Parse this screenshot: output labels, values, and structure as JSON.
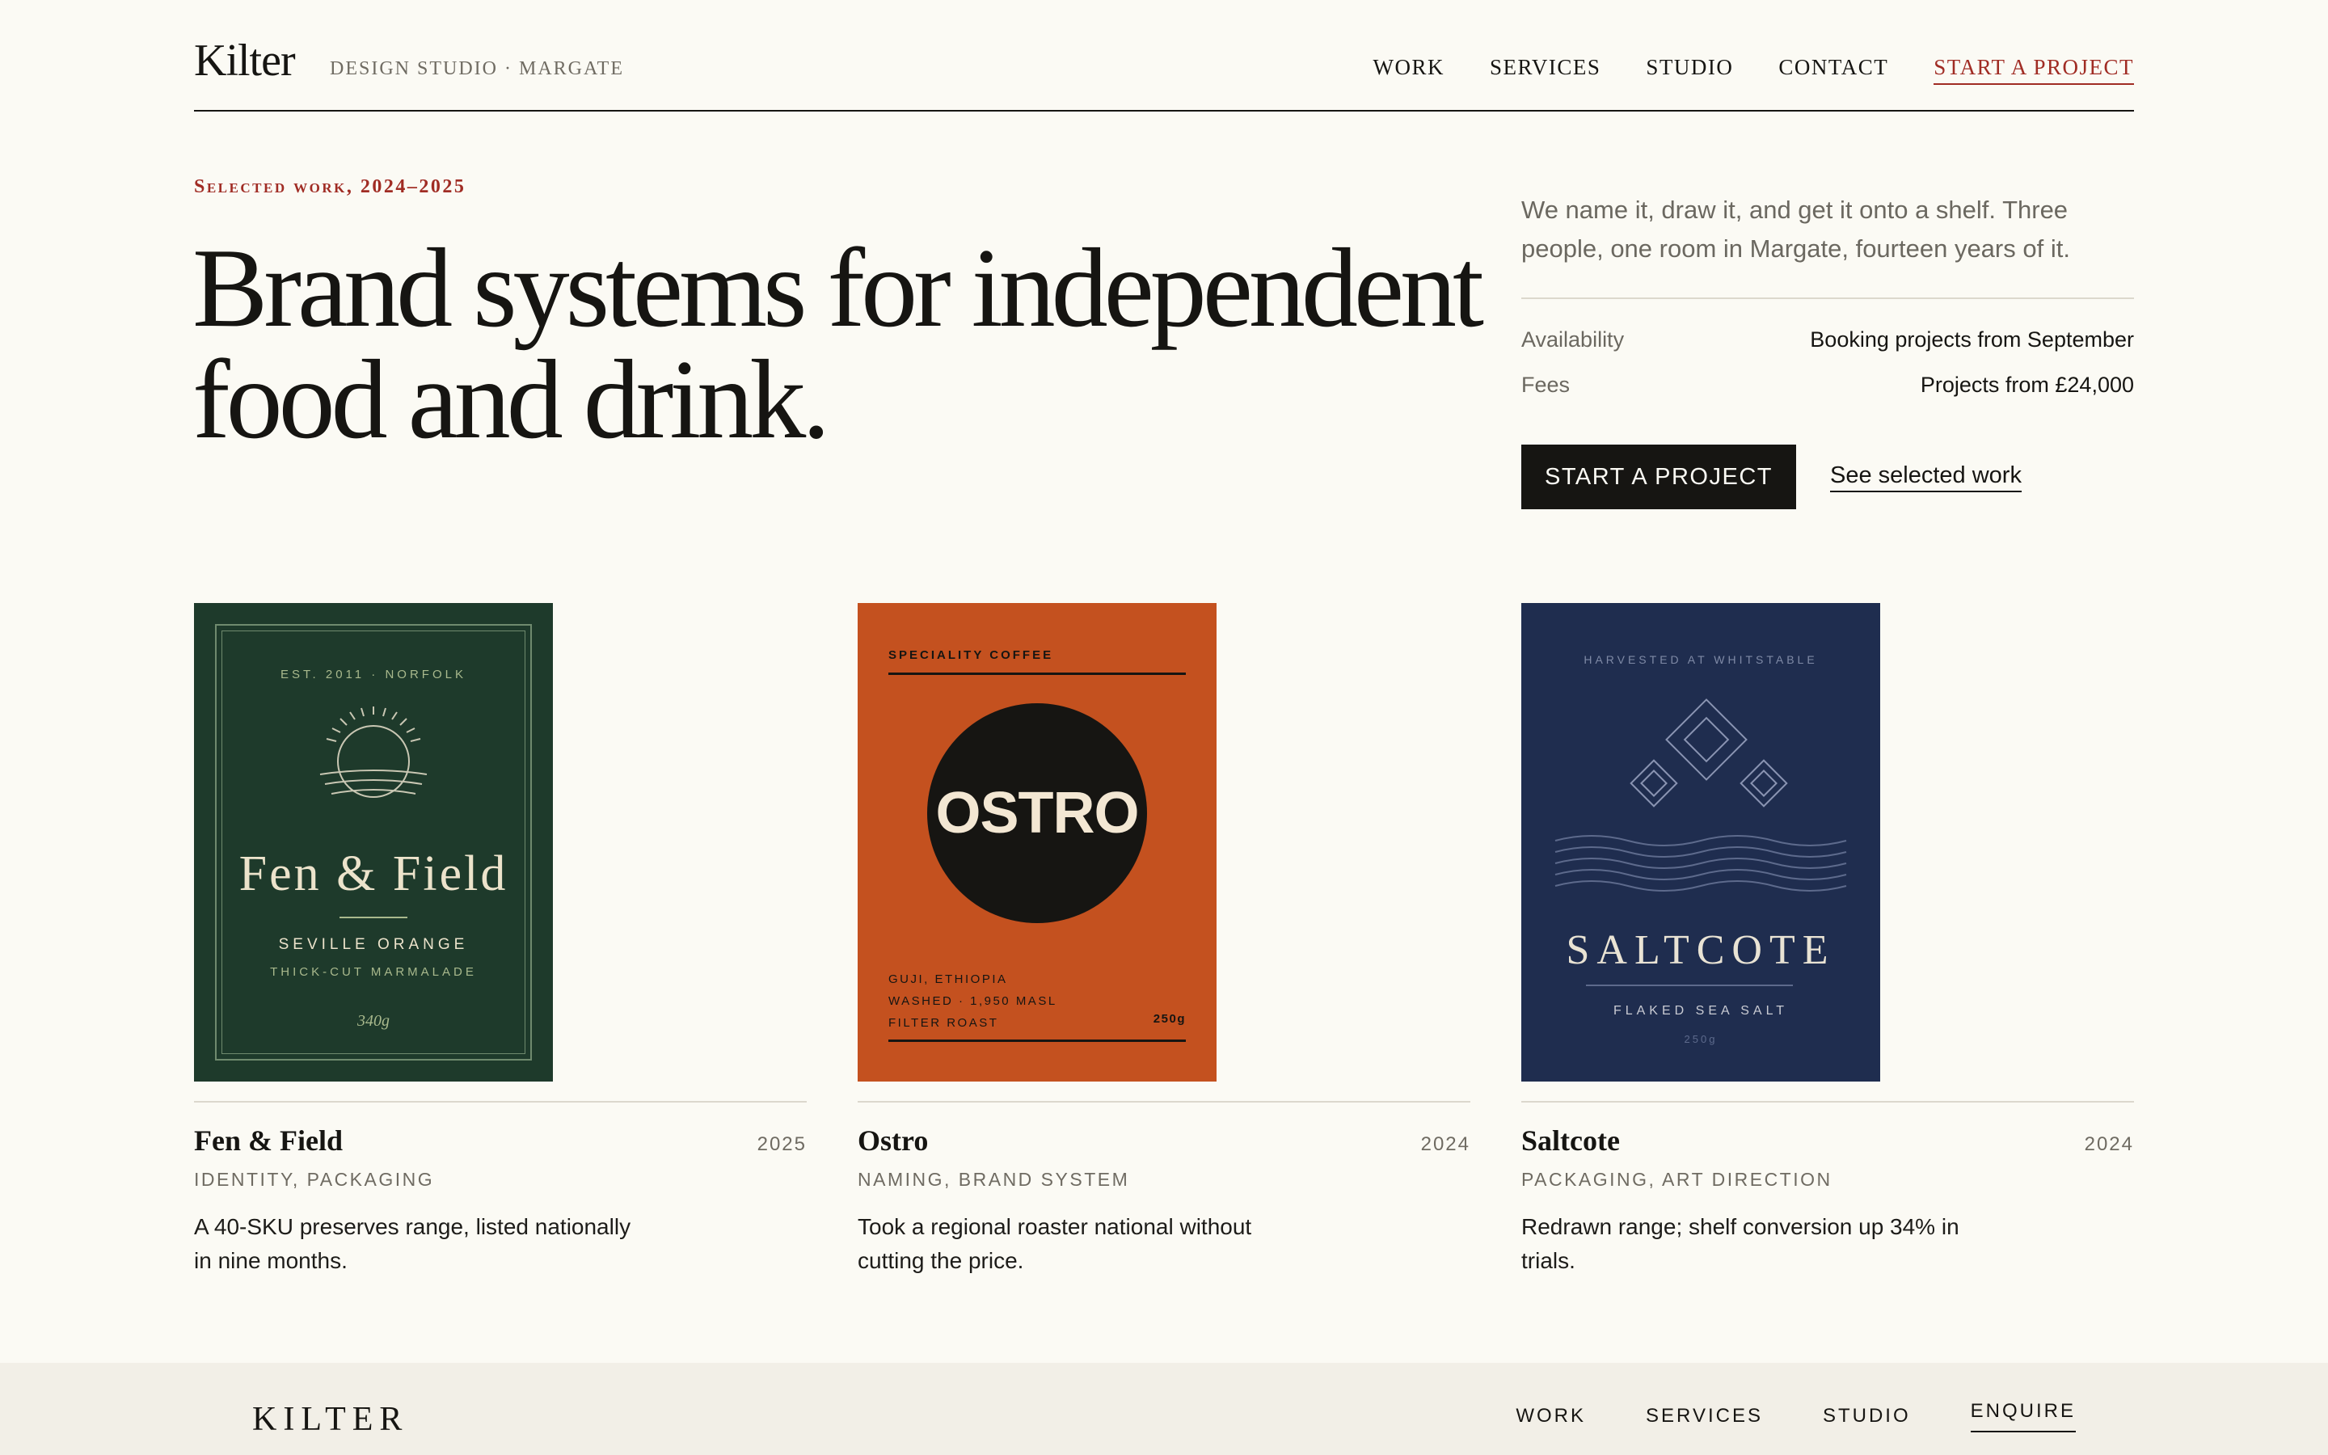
{
  "header": {
    "logo": "Kilter",
    "tagline": "DESIGN STUDIO · MARGATE",
    "nav": [
      {
        "label": "WORK"
      },
      {
        "label": "SERVICES"
      },
      {
        "label": "STUDIO"
      },
      {
        "label": "CONTACT"
      }
    ],
    "cta_label": "START A PROJECT"
  },
  "hero": {
    "eyebrow": "Selected work, 2024–2025",
    "title": "Brand systems for independent food and drink.",
    "description": "We name it, draw it, and get it onto a shelf. Three people, one room in Margate, fourteen years of it.",
    "info": [
      {
        "label": "Availability",
        "value": "Booking projects from September"
      },
      {
        "label": "Fees",
        "value": "Projects from £24,000"
      }
    ],
    "primary_button": "START A PROJECT",
    "secondary_link": "See selected work"
  },
  "projects": [
    {
      "title": "Fen & Field",
      "year": "2025",
      "tags": "IDENTITY, PACKAGING",
      "description": "A 40-SKU preserves range, listed nationally in nine months.",
      "label": {
        "est": "EST. 2011 · NORFOLK",
        "brand": "Fen & Field",
        "product": "SEVILLE ORANGE",
        "variant": "THICK-CUT MARMALADE",
        "weight": "340g",
        "color": "#1e3a2b"
      }
    },
    {
      "title": "Ostro",
      "year": "2024",
      "tags": "NAMING, BRAND SYSTEM",
      "description": "Took a regional roaster national without cutting the price.",
      "label": {
        "top": "SPECIALITY COFFEE",
        "brand": "OSTRO",
        "origin": "GUJI, ETHIOPIA",
        "process": "WASHED · 1,950 MASL",
        "roast": "FILTER ROAST",
        "weight": "250g",
        "color": "#c4511f"
      }
    },
    {
      "title": "Saltcote",
      "year": "2024",
      "tags": "PACKAGING, ART DIRECTION",
      "description": "Redrawn range; shelf conversion up 34% in trials.",
      "label": {
        "top": "HARVESTED AT WHITSTABLE",
        "brand": "SALTCOTE",
        "product": "FLAKED SEA SALT",
        "weight": "250g",
        "color": "#1f2d4f"
      }
    }
  ],
  "footer": {
    "logo": "KILTER",
    "nav": [
      {
        "label": "WORK"
      },
      {
        "label": "SERVICES"
      },
      {
        "label": "STUDIO"
      },
      {
        "label": "ENQUIRE"
      }
    ]
  },
  "colors": {
    "background": "#fbfaf4",
    "ink": "#161512",
    "accent": "#a02c24",
    "muted": "#6b6860",
    "footer_bg": "#f2efe7"
  }
}
